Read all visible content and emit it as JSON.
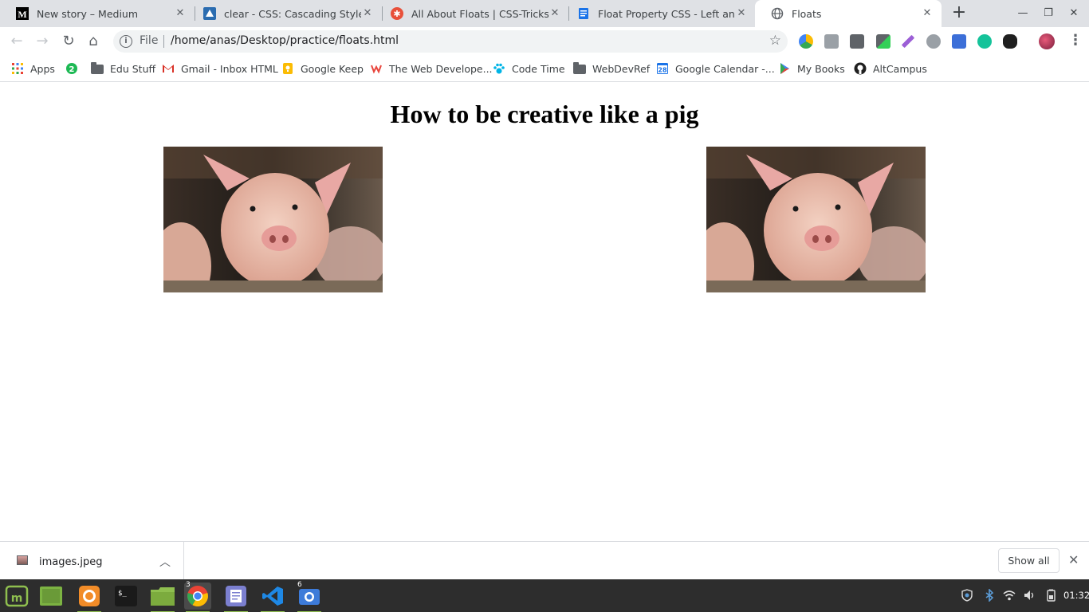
{
  "browser": {
    "tabs": [
      {
        "title": "New story – Medium",
        "icon": "medium-icon",
        "active": false
      },
      {
        "title": "clear - CSS: Cascading Style Sh",
        "icon": "mdn-icon",
        "active": false
      },
      {
        "title": "All About Floats | CSS-Tricks",
        "icon": "css-tricks-icon",
        "active": false
      },
      {
        "title": "Float Property CSS - Left and R",
        "icon": "document-icon",
        "active": false
      },
      {
        "title": "Floats",
        "icon": "globe-icon",
        "active": true
      }
    ],
    "new_tab_label": "+",
    "address": {
      "scheme": "File",
      "url": "/home/anas/Desktop/practice/floats.html"
    },
    "bookmarks": [
      {
        "label": "Apps",
        "icon": "apps-grid-icon"
      },
      {
        "label": "",
        "icon": "badge-2-icon",
        "badge": "2"
      },
      {
        "label": "Edu Stuff",
        "icon": "folder-icon"
      },
      {
        "label": "Gmail - Inbox HTML",
        "icon": "gmail-icon"
      },
      {
        "label": "Google Keep",
        "icon": "keep-icon"
      },
      {
        "label": "The Web Develope...",
        "icon": "web-dev-icon"
      },
      {
        "label": "Code Time",
        "icon": "paw-icon"
      },
      {
        "label": "WebDevRef",
        "icon": "folder-icon"
      },
      {
        "label": "Google Calendar -...",
        "icon": "calendar-icon",
        "calendar_day": "28"
      },
      {
        "label": "My Books",
        "icon": "play-books-icon"
      },
      {
        "label": "AltCampus",
        "icon": "github-icon"
      }
    ]
  },
  "page": {
    "heading": "How to be creative like a pig",
    "images": [
      {
        "alt": "pig",
        "position": "left"
      },
      {
        "alt": "pig",
        "position": "right"
      }
    ]
  },
  "downloads": {
    "file_name": "images.jpeg",
    "show_all_label": "Show all"
  },
  "taskbar": {
    "chrome_badge": "3",
    "screenshot_badge": "6",
    "clock": "01:32"
  },
  "colors": {
    "tabstrip": "#dfe1e5",
    "taskbar": "#2d2d2d",
    "accent_green": "#8fbf4f"
  }
}
